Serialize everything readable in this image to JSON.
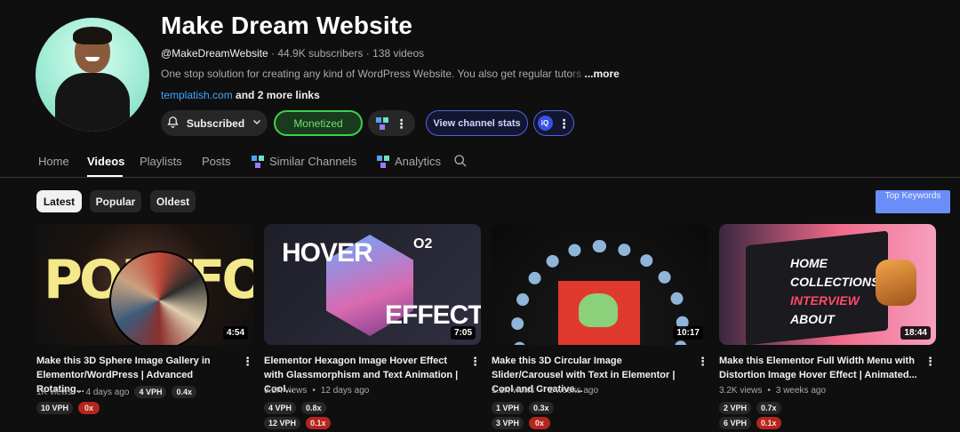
{
  "channel": {
    "name": "Make Dream Website",
    "handle": "@MakeDreamWebsite",
    "subscribers": "44.9K subscribers",
    "videos_count": "138 videos",
    "description": "One stop solution for creating any kind of WordPress Website. You also get regular tuto",
    "description_fade": "rs",
    "more_label": "...more",
    "link_text": "templatish.com",
    "more_links": "and 2 more links"
  },
  "actions": {
    "subscribed_label": "Subscribed",
    "monetized_label": "Monetized",
    "view_stats_label": "View channel stats",
    "ext_badge": "iQ"
  },
  "tabs": [
    {
      "label": "Home"
    },
    {
      "label": "Videos"
    },
    {
      "label": "Playlists"
    },
    {
      "label": "Posts"
    },
    {
      "label": "Similar Channels"
    },
    {
      "label": "Analytics"
    }
  ],
  "filters": {
    "latest": "Latest",
    "popular": "Popular",
    "oldest": "Oldest",
    "top_keywords": "Top Keywords"
  },
  "videos": [
    {
      "thumb_text": "PORTFOLIO",
      "duration": "4:54",
      "title": "Make this 3D Sphere Image Gallery in Elementor/WordPress | Advanced Rotating...",
      "views": "1K views",
      "age": "4 days ago",
      "vph": "4 VPH",
      "ratio": "0.4x",
      "vph2": "10 VPH",
      "ratio2": "0x"
    },
    {
      "thumb_text_1": "HOVER",
      "thumb_text_2": "EFFECT",
      "thumb_text_3": "O2",
      "duration": "7:05",
      "title": "Elementor Hexagon Image Hover Effect with Glassmorphism and Text Animation | Cool...",
      "views": "3.5K views",
      "age": "12 days ago",
      "vph": "4 VPH",
      "ratio": "0.8x",
      "vph2": "12 VPH",
      "ratio2": "0.1x"
    },
    {
      "duration": "10:17",
      "title": "Make this 3D Circular Image Slider/Carousel with Text in Elementor | Cool and Creative...",
      "views": "1.1K views",
      "age": "2 weeks ago",
      "vph": "1 VPH",
      "ratio": "0.3x",
      "vph2": "3 VPH",
      "ratio2": "0x"
    },
    {
      "menu_items": [
        "HOME",
        "COLLECTIONS",
        "INTERVIEW",
        "ABOUT"
      ],
      "duration": "18:44",
      "title": "Make this Elementor Full Width Menu with Distortion Image Hover Effect | Animated...",
      "views": "3.2K views",
      "age": "3 weeks ago",
      "vph": "2 VPH",
      "ratio": "0.7x",
      "vph2": "6 VPH",
      "ratio2": "0.1x"
    }
  ],
  "colors": {
    "background": "#0f0f0f",
    "monetized_green": "#3fd14a",
    "accent_blue": "#4e63e6",
    "top_keywords_bg": "#6b8df8",
    "ratio_red": "#b3261e",
    "link_blue": "#3ea6ff"
  },
  "icons": [
    "bell-icon",
    "chevron-down-icon",
    "vidiq-logo-icon",
    "more-vert-icon",
    "search-icon"
  ]
}
